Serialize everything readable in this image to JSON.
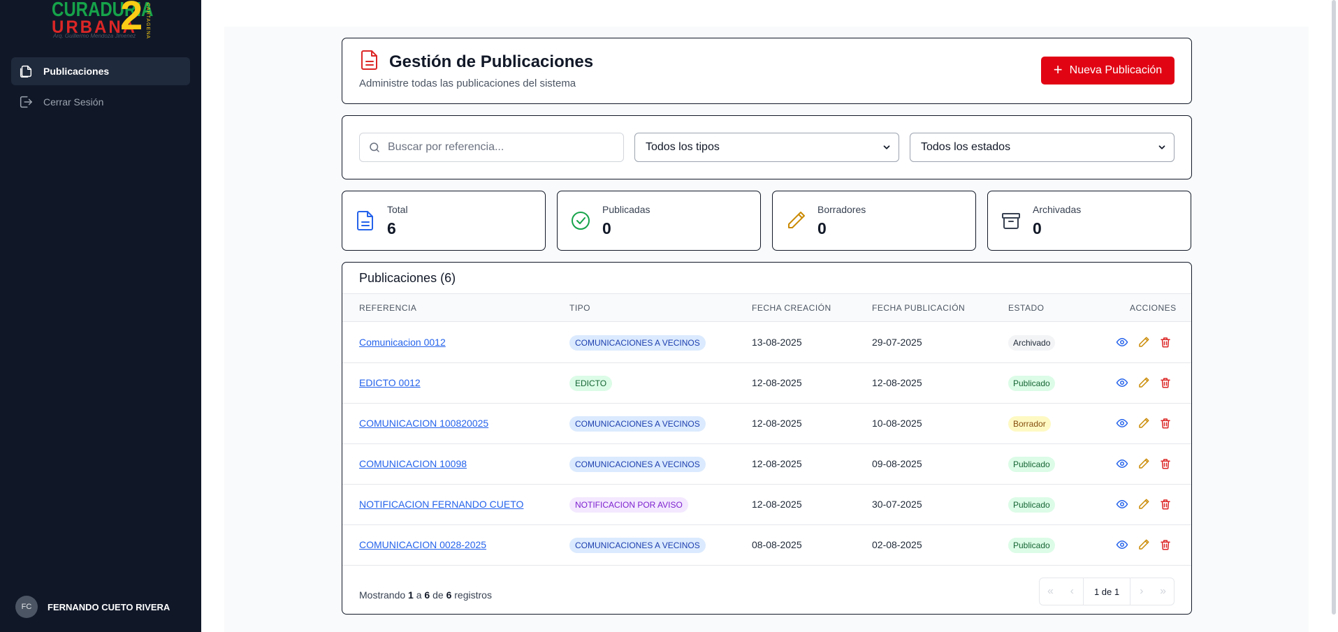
{
  "logo": {
    "line1": "CURADURIA",
    "line2": "URBANA",
    "number": "2",
    "side_text": "CARTAGENA",
    "subtitle": "Arq. Guillermo Mendoza Jimenez"
  },
  "sidebar": {
    "items": [
      {
        "label": "Publicaciones",
        "icon": "file-copy-icon",
        "active": true
      },
      {
        "label": "Cerrar Sesión",
        "icon": "logout-icon",
        "active": false
      }
    ],
    "user": {
      "initials": "FC",
      "name": "FERNANDO CUETO RIVERA"
    }
  },
  "header": {
    "title": "Gestión de Publicaciones",
    "subtitle": "Administre todas las publicaciones del sistema",
    "new_button": "Nueva Publicación",
    "icon": "file-text-icon"
  },
  "filters": {
    "search_placeholder": "Buscar por referencia...",
    "type_select": "Todos los tipos",
    "status_select": "Todos los estados"
  },
  "stats": [
    {
      "label": "Total",
      "value": "6",
      "icon": "file-text-icon",
      "color": "#2563eb"
    },
    {
      "label": "Publicadas",
      "value": "0",
      "icon": "check-circle-icon",
      "color": "#16a34a"
    },
    {
      "label": "Borradores",
      "value": "0",
      "icon": "pencil-icon",
      "color": "#ca8a04"
    },
    {
      "label": "Archivadas",
      "value": "0",
      "icon": "archive-icon",
      "color": "#374151"
    }
  ],
  "table": {
    "title": "Publicaciones (6)",
    "columns": [
      "REFERENCIA",
      "TIPO",
      "FECHA CREACIÓN",
      "FECHA PUBLICACIÓN",
      "ESTADO",
      "ACCIONES"
    ],
    "rows": [
      {
        "ref": "Comunicacion 0012",
        "tipo": "COMUNICACIONES A VECINOS",
        "creacion": "13-08-2025",
        "publicacion": "29-07-2025",
        "estado": "Archivado"
      },
      {
        "ref": "EDICTO 0012",
        "tipo": "EDICTO",
        "creacion": "12-08-2025",
        "publicacion": "12-08-2025",
        "estado": "Publicado"
      },
      {
        "ref": "COMUNICACION 100820025",
        "tipo": "COMUNICACIONES A VECINOS",
        "creacion": "12-08-2025",
        "publicacion": "10-08-2025",
        "estado": "Borrador"
      },
      {
        "ref": "COMUNICACION 10098",
        "tipo": "COMUNICACIONES A VECINOS",
        "creacion": "12-08-2025",
        "publicacion": "09-08-2025",
        "estado": "Publicado"
      },
      {
        "ref": "NOTIFICACION FERNANDO CUETO",
        "tipo": "NOTIFICACION POR AVISO",
        "creacion": "12-08-2025",
        "publicacion": "30-07-2025",
        "estado": "Publicado"
      },
      {
        "ref": "COMUNICACION 0028-2025",
        "tipo": "COMUNICACIONES A VECINOS",
        "creacion": "08-08-2025",
        "publicacion": "02-08-2025",
        "estado": "Publicado"
      }
    ],
    "footer": {
      "prefix": "Mostrando",
      "from": "1",
      "a": "a",
      "to": "6",
      "de": "de",
      "total": "6",
      "suffix": "registros"
    },
    "pager": {
      "current": "1 de 1",
      "first": "«",
      "prev": "‹",
      "next": "›",
      "last": "»"
    }
  },
  "colors": {
    "accent": "#e10514",
    "sidebar_bg": "#101828",
    "link": "#2563eb",
    "badge_vecinos_bg": "#dbeafe",
    "badge_vecinos_fg": "#1e40af",
    "badge_edicto_bg": "#dcfce7",
    "badge_edicto_fg": "#166534",
    "badge_aviso_bg": "#f3e8ff",
    "badge_aviso_fg": "#7e22ce",
    "status_archivado_bg": "#f3f4f6",
    "status_archivado_fg": "#1f2937",
    "status_publicado_bg": "#dcfce7",
    "status_publicado_fg": "#166534",
    "status_borrador_bg": "#fef9c3",
    "status_borrador_fg": "#854d0e"
  }
}
